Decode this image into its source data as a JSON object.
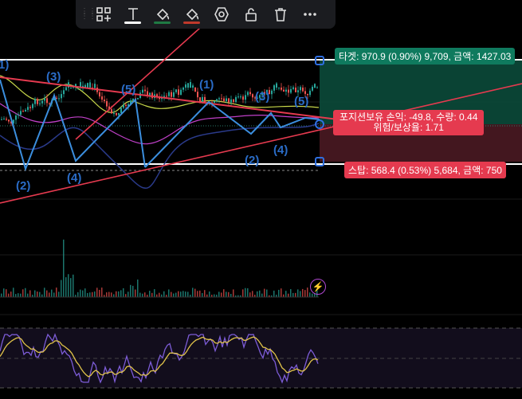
{
  "toolbar": {
    "tools": [
      {
        "name": "add-grid-icon"
      },
      {
        "name": "text-tool-icon"
      },
      {
        "name": "fill-bucket-icon"
      },
      {
        "name": "line-color-icon"
      },
      {
        "name": "settings-hexagon-icon"
      },
      {
        "name": "unlock-icon"
      },
      {
        "name": "trash-icon"
      },
      {
        "name": "more-options-icon"
      }
    ]
  },
  "trade": {
    "target_label": "타겟: 970.9 (0.90%) 9,709, 금액: 1427.03",
    "position_line1": "포지션보유 손익: -49.8, 수량: 0.44",
    "position_line2": "위험/보상율: 1.71",
    "stop_label": "스탑: 568.4 (0.53%) 5,684, 금액: 750"
  },
  "waves": [
    "1)",
    "(3)",
    "(5)",
    "(2)",
    "(4)",
    "(1)",
    "(3)",
    "(5)",
    "(2)",
    "(4)"
  ],
  "colors": {
    "target_zone": "#0b4a3a",
    "stop_zone": "#4a1a22",
    "wave_line": "#3b8ede",
    "trend_line": "#e53a4f",
    "rsi_line": "#7c5cd6",
    "rsi_ma": "#e0c34a",
    "up_candle": "#26a69a",
    "down_candle": "#ef5350"
  }
}
